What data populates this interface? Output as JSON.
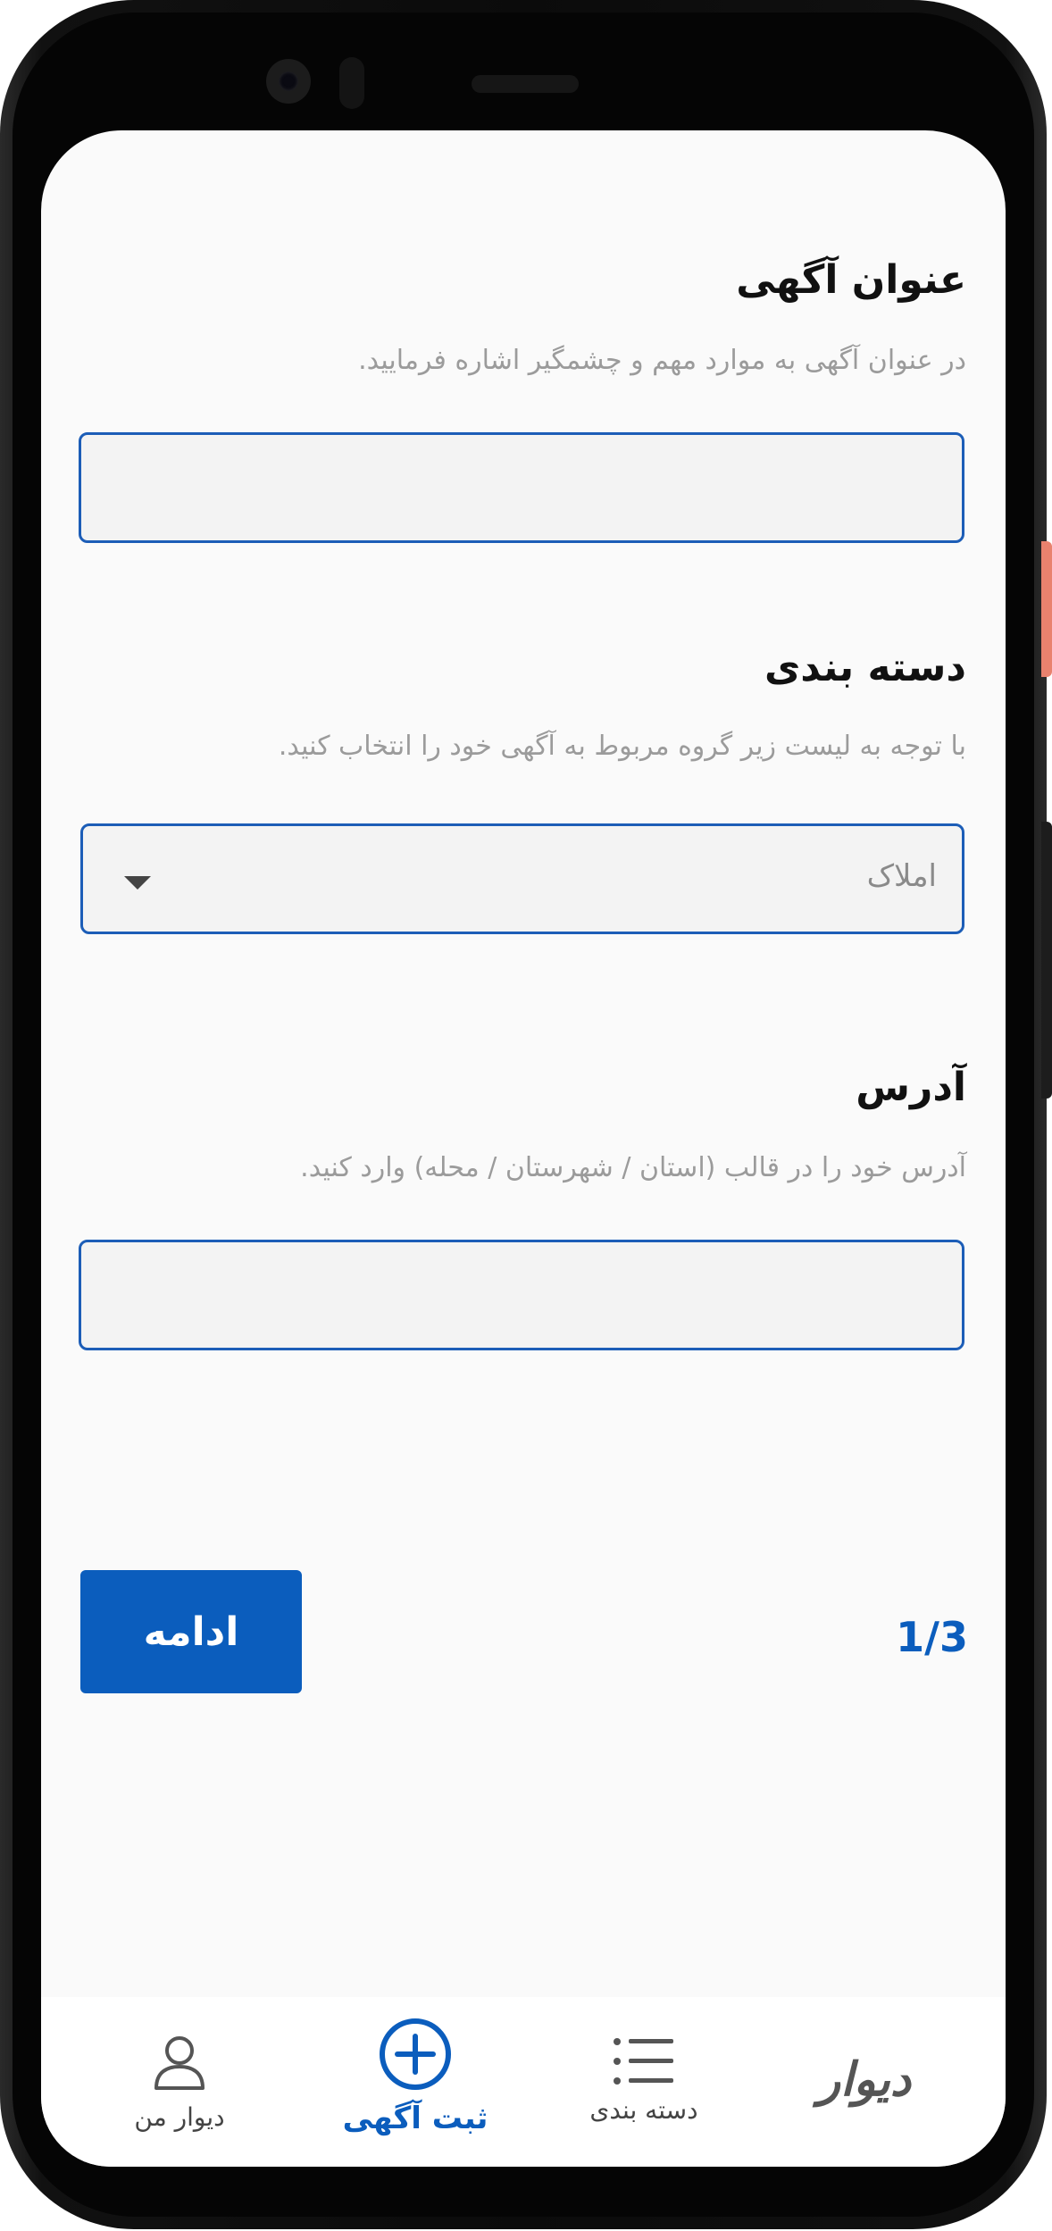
{
  "form": {
    "title_field": {
      "label": "عنوان آگهی",
      "description": "در عنوان آگهی به موارد مهم و چشمگیر اشاره فرمایید.",
      "value": ""
    },
    "category_field": {
      "label": "دسته بندی",
      "description": "با توجه به لیست زیر گروه مربوط به آگهی خود را انتخاب کنید.",
      "selected": "املاک"
    },
    "address_field": {
      "label": "آدرس",
      "description": "آدرس خود را در قالب (استان / شهرستان / محله) وارد کنید.",
      "value": ""
    },
    "continue_label": "ادامه",
    "step": "1/3"
  },
  "bottom_nav": {
    "logo": "دیوار",
    "categories": "دسته بندی",
    "post_ad": "ثبت آگهی",
    "my_divar": "دیوار من"
  },
  "colors": {
    "accent": "#0b5dbd",
    "field_border": "#1c5db7",
    "field_bg": "#f3f3f3",
    "screen_bg": "#fafafa"
  },
  "icons": [
    "chevron-down-icon",
    "list-icon",
    "plus-circle-icon",
    "user-icon"
  ]
}
